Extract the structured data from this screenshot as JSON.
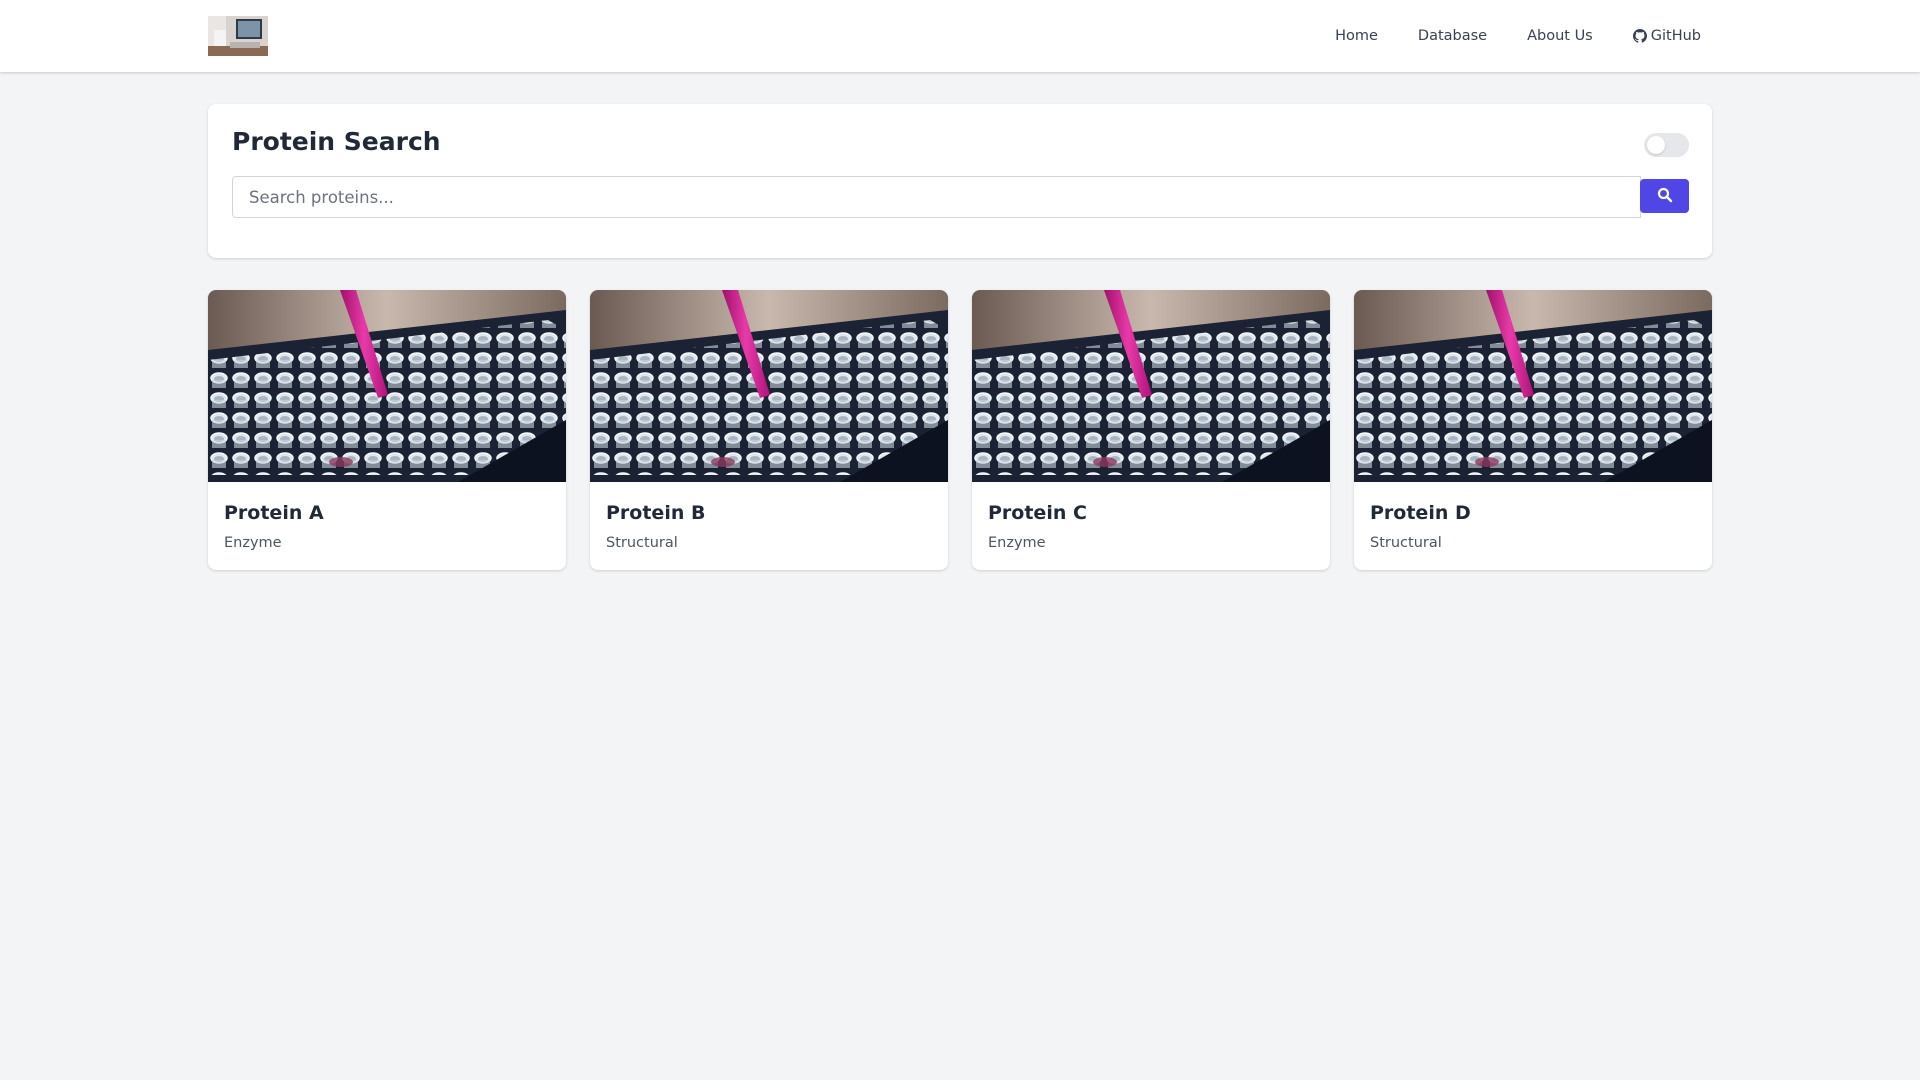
{
  "nav": {
    "links": [
      {
        "label": "Home"
      },
      {
        "label": "Database"
      },
      {
        "label": "About Us"
      },
      {
        "label": "GitHub",
        "icon": "github-icon"
      }
    ]
  },
  "search": {
    "title": "Protein Search",
    "placeholder": "Search proteins...",
    "button_icon": "search-icon",
    "toggle_on": false
  },
  "proteins": [
    {
      "name": "Protein A",
      "type": "Enzyme"
    },
    {
      "name": "Protein B",
      "type": "Structural"
    },
    {
      "name": "Protein C",
      "type": "Enzyme"
    },
    {
      "name": "Protein D",
      "type": "Structural"
    }
  ],
  "colors": {
    "accent": "#4f46e5",
    "background": "#f3f4f6",
    "pipette": "#d6208f"
  }
}
